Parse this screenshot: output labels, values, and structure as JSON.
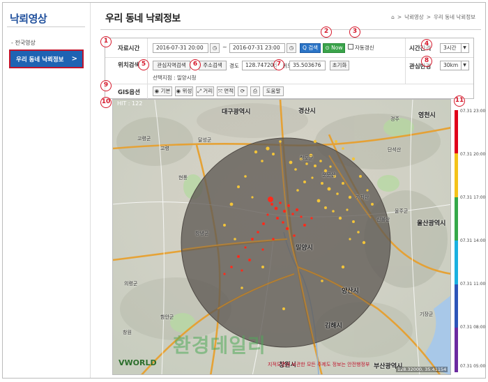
{
  "sidebar": {
    "brand": "낙뢰영상",
    "sub_item": "- 전국영상",
    "active_item": "우리 동네 낙뢰정보",
    "active_chevron": ">"
  },
  "header": {
    "title": "우리 동네 낙뢰정보",
    "breadcrumb": [
      "⌂",
      ">",
      "낙뢰영상",
      ">",
      "우리 동네 낙뢰정보"
    ]
  },
  "form": {
    "data_time_label": "자료시간",
    "start_time": "2016-07-31 20:00",
    "tilde": "~",
    "end_time": "2016-07-31 23:00",
    "search_button": "Q 검색",
    "now_button": "⊙ Now",
    "auto_refresh_label": "자동갱신",
    "interval_label": "시간간격",
    "interval_value": "3시간",
    "location_label": "위치검색",
    "region_search_button": "관심지역검색",
    "address_search_button": "주소검색",
    "lon_label": "경도",
    "lon_value": "128.747206",
    "lat_label": "위도",
    "lat_value": "35.503676",
    "reset_button": "초기화",
    "selected_label": "선택지점 : 밀양시청",
    "radius_label": "관심반경",
    "radius_value": "30km",
    "gis_label": "GIS옵션",
    "gis_buttons": [
      "◉ 기본",
      "◉ 위성",
      "⤢ 거리",
      "⤧ 면적",
      "⟳",
      "⎙",
      "도움말"
    ]
  },
  "markers": [
    "1",
    "2",
    "3",
    "4",
    "5",
    "6",
    "7",
    "8",
    "9",
    "10",
    "11"
  ],
  "map": {
    "hit_text": "HIT : 122",
    "cities": [
      "대구광역시",
      "경산시",
      "밀양시",
      "양산시",
      "김해시",
      "창원시",
      "울산광역시",
      "영천시",
      "부산광역시"
    ],
    "towns": [
      "고령군",
      "고령",
      "달성군",
      "현풍",
      "창녕군",
      "청도군",
      "운문산",
      "경주",
      "단석산",
      "울주군",
      "가지산",
      "신불산",
      "의령군",
      "함안군",
      "기장군",
      "창원"
    ],
    "watermark": "환경데일리",
    "vworld": "VWORLD",
    "copyright": "지적도면과 보관한 모든 주제도 정보는 안전행정부",
    "coords": "128.32000, 35.41154",
    "colors": {
      "circle": "#5f5a55",
      "road": "#e7a02f",
      "strike_recent": "#ff2a1a",
      "strike_old": "#f2c43a"
    }
  },
  "legend": {
    "labels": [
      "07.31 23:00",
      "07.31 20:00",
      "07.31 17:00",
      "07.31 14:00",
      "07.31 11:00",
      "07.31 08:00",
      "07.31 05:00"
    ],
    "colors": [
      "#e0001b",
      "#f4c21a",
      "#35a84a",
      "#1ab0e0",
      "#2d55b8",
      "#6c2aa0"
    ]
  },
  "zoom": "28.3"
}
